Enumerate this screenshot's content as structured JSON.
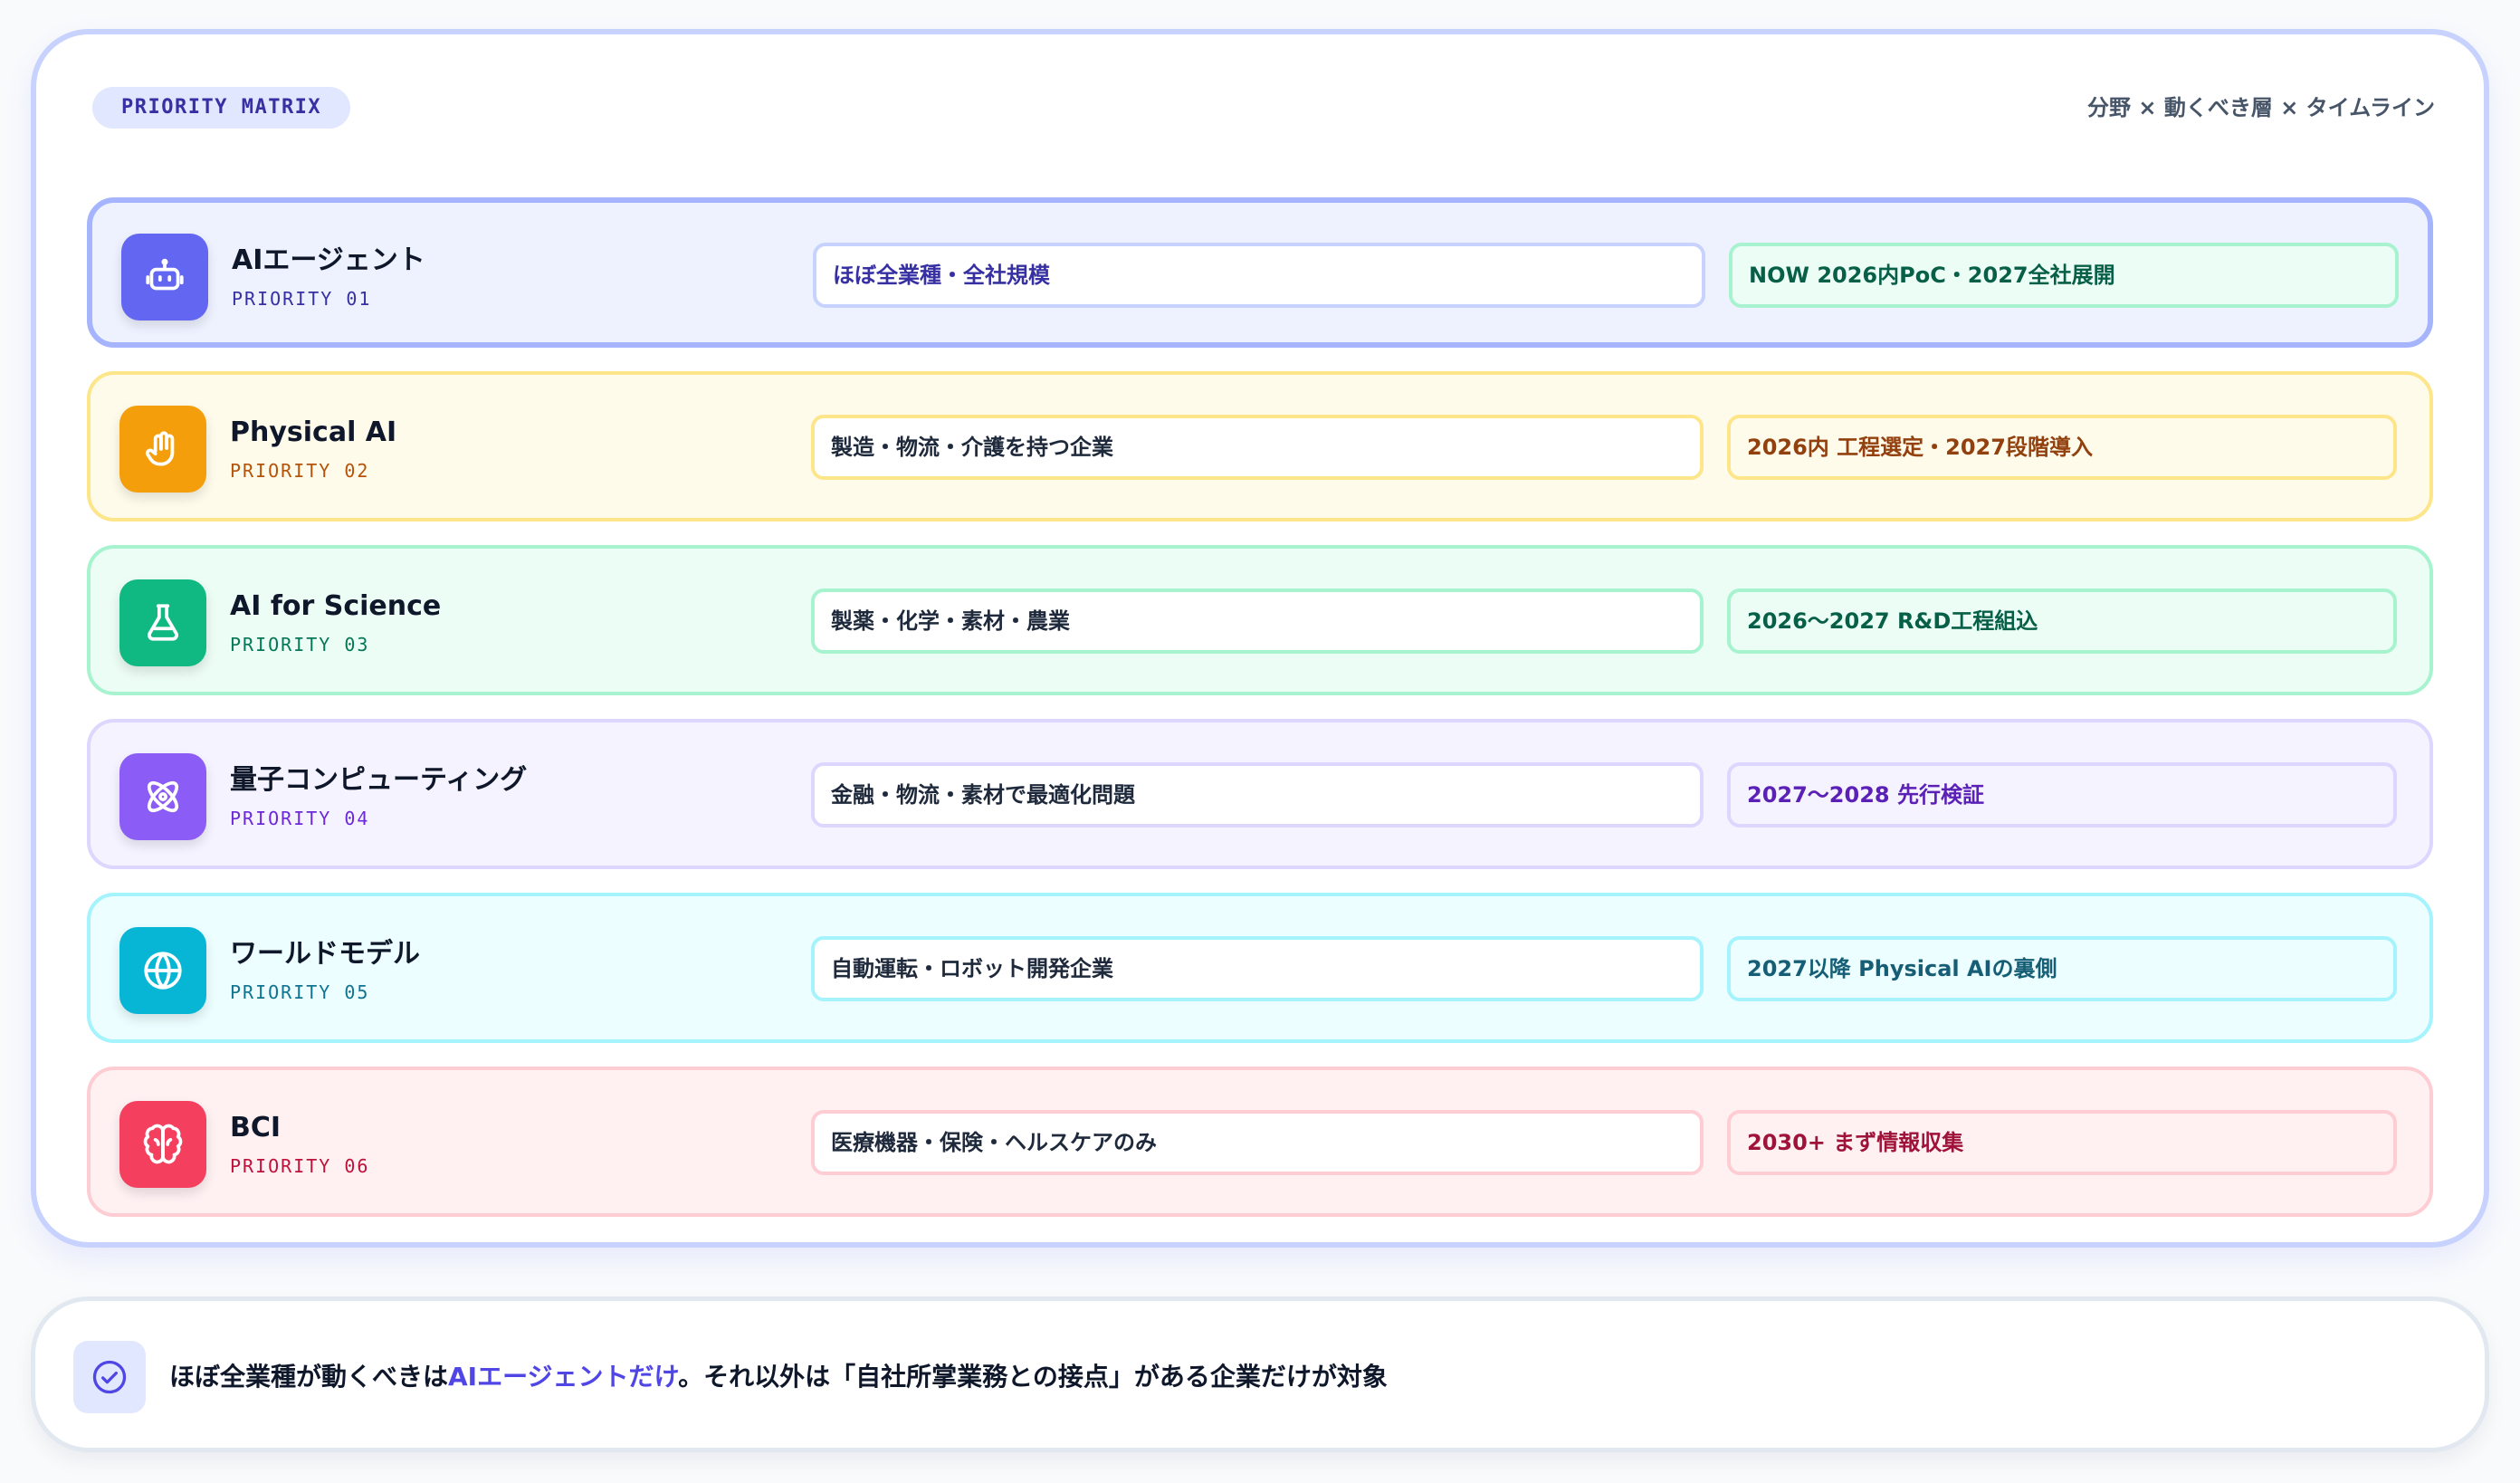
{
  "header": {
    "badge": "PRIORITY MATRIX",
    "subtitle": "分野 × 動くべき層 × タイムライン"
  },
  "rows": [
    {
      "title": "AIエージェント",
      "priority": "PRIORITY 01",
      "scope": "ほぼ全業種・全社規模",
      "timeline": "NOW 2026内PoC・2027全社展開",
      "icon": "robot-icon",
      "colors": {
        "bg": "#eef2ff",
        "border": "#a5b4fc",
        "icon": "#6366f1",
        "accent": "#3730a3",
        "scope_text": "#3730a3",
        "scope_border": "#c7d2fe",
        "time_bg": "#ecfdf5",
        "time_border": "#a7f3d0",
        "time_text": "#065f46"
      }
    },
    {
      "title": "Physical AI",
      "priority": "PRIORITY 02",
      "scope": "製造・物流・介護を持つ企業",
      "timeline": "2026内 工程選定・2027段階導入",
      "icon": "hand-icon",
      "colors": {
        "bg": "#fffbeb",
        "border": "#fde68a",
        "icon": "#f59e0b",
        "accent": "#b45309",
        "scope_text": "#1e293b",
        "scope_border": "#fde68a",
        "time_bg": "#fffbeb",
        "time_border": "#fde68a",
        "time_text": "#92400e"
      }
    },
    {
      "title": "AI for Science",
      "priority": "PRIORITY 03",
      "scope": "製薬・化学・素材・農業",
      "timeline": "2026〜2027 R&D工程組込",
      "icon": "flask-icon",
      "colors": {
        "bg": "#ecfdf5",
        "border": "#a7f3d0",
        "icon": "#10b981",
        "accent": "#047857",
        "scope_text": "#1e293b",
        "scope_border": "#a7f3d0",
        "time_bg": "#ecfdf5",
        "time_border": "#a7f3d0",
        "time_text": "#065f46"
      }
    },
    {
      "title": "量子コンピューティング",
      "priority": "PRIORITY 04",
      "scope": "金融・物流・素材で最適化問題",
      "timeline": "2027〜2028 先行検証",
      "icon": "atom-icon",
      "colors": {
        "bg": "#f5f3ff",
        "border": "#ddd6fe",
        "icon": "#8b5cf6",
        "accent": "#6d28d9",
        "scope_text": "#1e293b",
        "scope_border": "#ddd6fe",
        "time_bg": "#f5f3ff",
        "time_border": "#ddd6fe",
        "time_text": "#5b21b6"
      }
    },
    {
      "title": "ワールドモデル",
      "priority": "PRIORITY 05",
      "scope": "自動運転・ロボット開発企業",
      "timeline": "2027以降 Physical AIの裏側",
      "icon": "globe-icon",
      "colors": {
        "bg": "#ecfeff",
        "border": "#a5f3fc",
        "icon": "#06b6d4",
        "accent": "#0e7490",
        "scope_text": "#1e293b",
        "scope_border": "#a5f3fc",
        "time_bg": "#ecfeff",
        "time_border": "#a5f3fc",
        "time_text": "#155e75"
      }
    },
    {
      "title": "BCI",
      "priority": "PRIORITY 06",
      "scope": "医療機器・保険・ヘルスケアのみ",
      "timeline": "2030+ まず情報収集",
      "icon": "brain-icon",
      "colors": {
        "bg": "#fff1f2",
        "border": "#fecdd3",
        "icon": "#f43f5e",
        "accent": "#be123c",
        "scope_text": "#1e293b",
        "scope_border": "#fecdd3",
        "time_bg": "#fff1f2",
        "time_border": "#fecdd3",
        "time_text": "#9f1239"
      }
    }
  ],
  "footer": {
    "icon": "check-circle-icon",
    "text_pre": "ほぼ全業種が動くべきは",
    "text_highlight": "AIエージェントだけ",
    "text_post": "。それ以外は「自社所掌業務との接点」がある企業だけが対象",
    "highlight_color": "#4f46e5"
  }
}
